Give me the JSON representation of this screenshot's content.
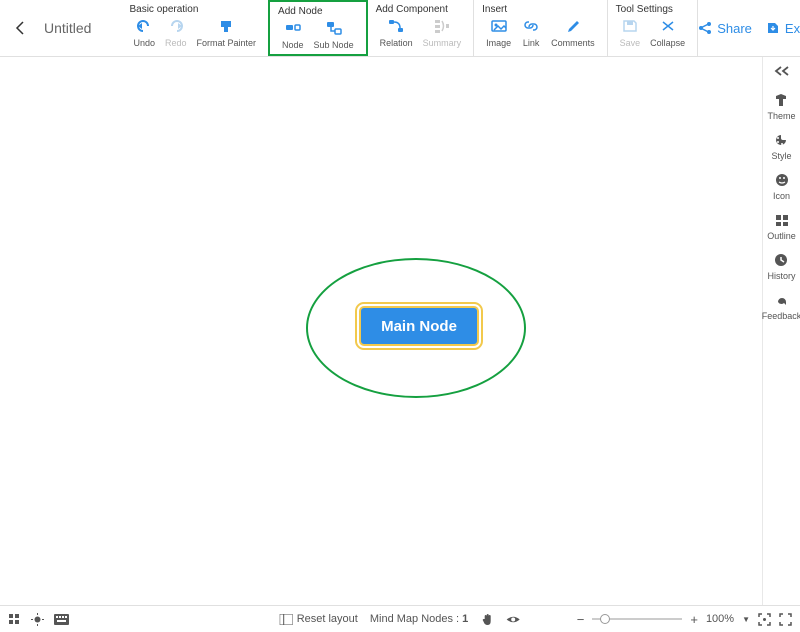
{
  "title": "Untitled",
  "toolbar": {
    "basic": {
      "label": "Basic operation",
      "undo": "Undo",
      "redo": "Redo",
      "format_painter": "Format Painter"
    },
    "add_node": {
      "label": "Add Node",
      "node": "Node",
      "sub_node": "Sub Node"
    },
    "add_component": {
      "label": "Add Component",
      "relation": "Relation",
      "summary": "Summary"
    },
    "insert": {
      "label": "Insert",
      "image": "Image",
      "link": "Link",
      "comments": "Comments"
    },
    "tool_settings": {
      "label": "Tool Settings",
      "save": "Save",
      "collapse": "Collapse"
    }
  },
  "actions": {
    "share": "Share",
    "export": "Export"
  },
  "canvas": {
    "main_node": "Main Node"
  },
  "sidebar": {
    "theme": "Theme",
    "style": "Style",
    "icon": "Icon",
    "outline": "Outline",
    "history": "History",
    "feedback": "Feedback"
  },
  "footer": {
    "reset_layout": "Reset layout",
    "node_count_label": "Mind Map Nodes :",
    "node_count": "1",
    "zoom": "100%"
  }
}
